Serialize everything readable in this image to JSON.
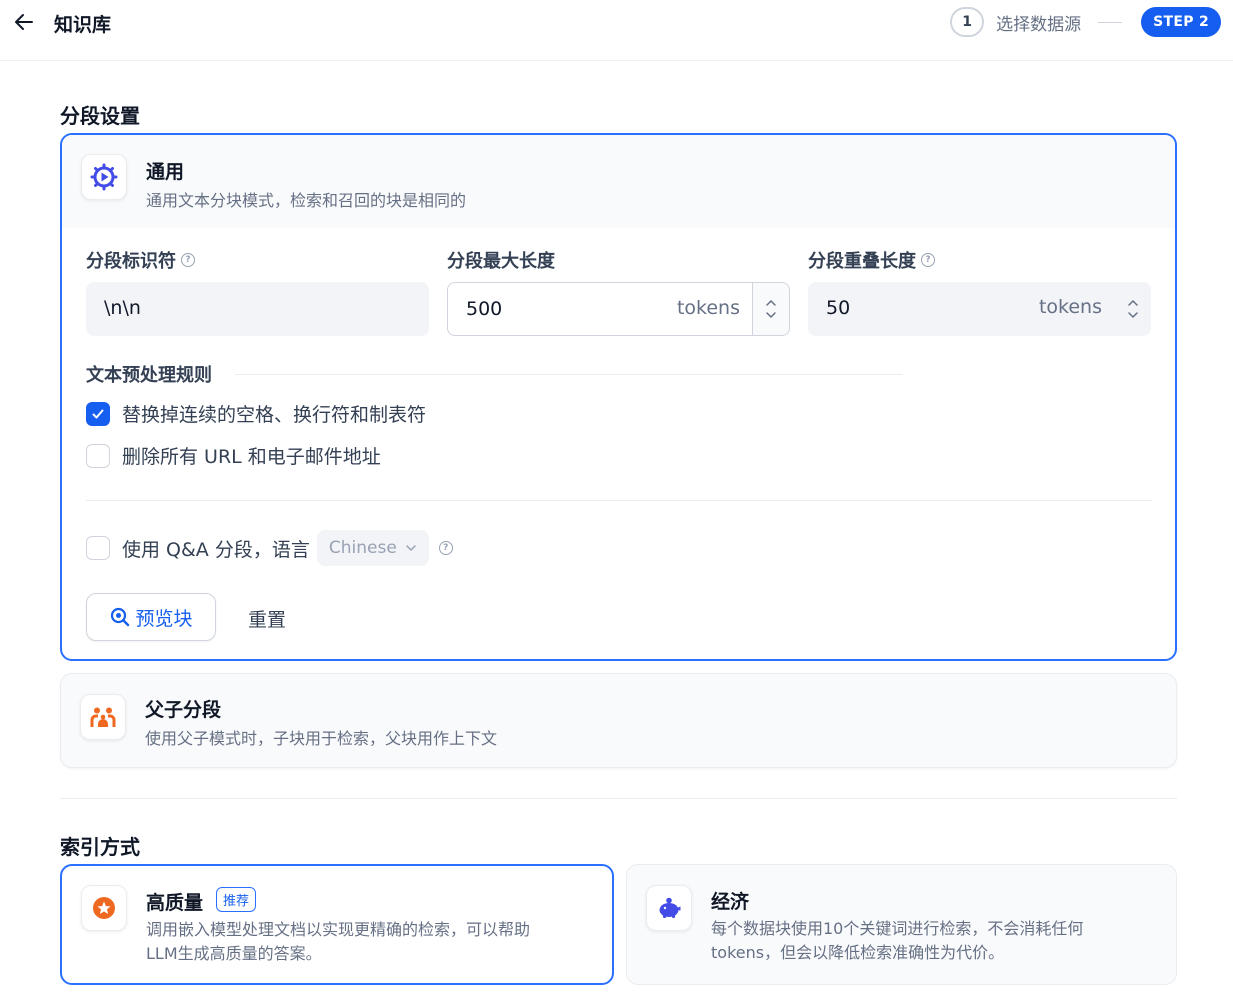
{
  "header": {
    "title": "知识库",
    "step1_number": "1",
    "step1_label": "选择数据源",
    "step2_label": "STEP 2"
  },
  "segment_section": {
    "title": "分段设置",
    "general": {
      "title": "通用",
      "description": "通用文本分块模式，检索和召回的块是相同的",
      "separator_label": "分段标识符",
      "separator_value": "\\n\\n",
      "max_length_label": "分段最大长度",
      "max_length_value": "500",
      "max_length_unit": "tokens",
      "overlap_label": "分段重叠长度",
      "overlap_value": "50",
      "overlap_unit": "tokens",
      "rules_title": "文本预处理规则",
      "rule_replace_spaces": "替换掉连续的空格、换行符和制表符",
      "rule_replace_spaces_checked": true,
      "rule_remove_urls": "删除所有 URL 和电子邮件地址",
      "rule_remove_urls_checked": false,
      "qa_label": "使用 Q&A 分段，语言",
      "qa_checked": false,
      "qa_language": "Chinese",
      "preview_button": "预览块",
      "reset_button": "重置"
    },
    "parent_child": {
      "title": "父子分段",
      "description": "使用父子模式时，子块用于检索，父块用作上下文"
    }
  },
  "index_section": {
    "title": "索引方式",
    "high_quality": {
      "title": "高质量",
      "badge": "推荐",
      "description_line1": "调用嵌入模型处理文档以实现更精确的检索，可以帮助",
      "description_line2": "LLM生成高质量的答案。"
    },
    "economy": {
      "title": "经济",
      "description_line1": "每个数据块使用10个关键词进行检索，不会消耗任何",
      "description_line2": "tokens，但会以降低检索准确性为代价。"
    }
  },
  "colors": {
    "accent": "#155eef",
    "border_active": "#2970ff",
    "text_primary": "#101828",
    "text_secondary": "#667085"
  }
}
